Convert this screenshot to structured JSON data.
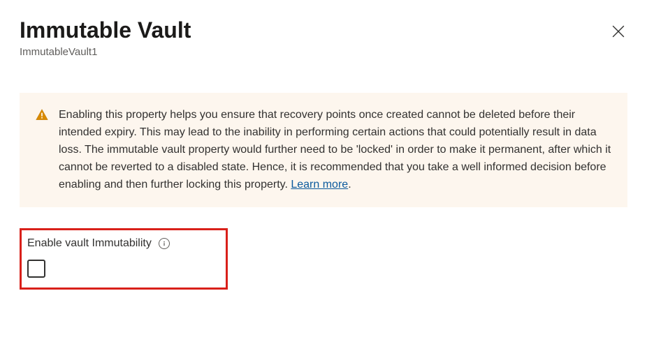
{
  "header": {
    "title": "Immutable Vault",
    "subtitle": "ImmutableVault1"
  },
  "warning": {
    "text": "Enabling this property helps you ensure that recovery points once created cannot be deleted before their intended expiry. This may lead to the inability in performing certain actions that could potentially result in data loss. The immutable vault property would further need to be 'locked' in order to make it permanent, after which it cannot be reverted to a disabled state. Hence, it is recommended that you take a well informed decision before enabling and then further locking this property. ",
    "learn_more_label": "Learn more"
  },
  "control": {
    "label": "Enable vault Immutability",
    "checked": false
  }
}
